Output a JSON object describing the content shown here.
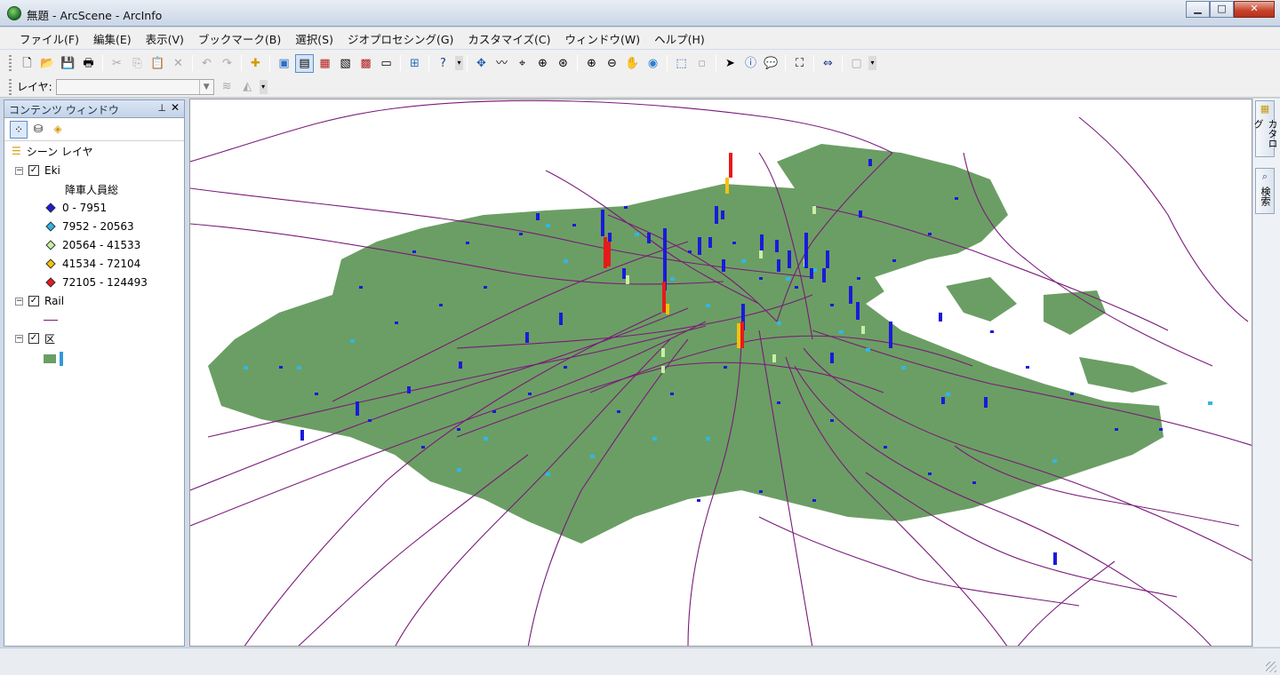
{
  "window": {
    "title": "無題 - ArcScene - ArcInfo",
    "min": "▁",
    "max": "□",
    "close": "✕"
  },
  "menu": [
    "ファイル(F)",
    "編集(E)",
    "表示(V)",
    "ブックマーク(B)",
    "選択(S)",
    "ジオプロセシング(G)",
    "カスタマイズ(C)",
    "ウィンドウ(W)",
    "ヘルプ(H)"
  ],
  "toolbar": {
    "layer_label": "レイヤ:",
    "layer_value": ""
  },
  "toc": {
    "title": "コンテンツ ウィンドウ",
    "root": "シーン レイヤ",
    "layers": [
      {
        "name": "Eki",
        "checked": true,
        "field": "降車人員総"
      },
      {
        "name": "Rail",
        "checked": true
      },
      {
        "name": "区",
        "checked": true
      }
    ],
    "classes": [
      {
        "label": "0 - 7951",
        "color": "#1a1adb"
      },
      {
        "label": "7952 - 20563",
        "color": "#2fb7e6"
      },
      {
        "label": "20564 - 41533",
        "color": "#c9f0a2"
      },
      {
        "label": "41534 - 72104",
        "color": "#f3c20f"
      },
      {
        "label": "72105 - 124493",
        "color": "#e51b1b"
      }
    ],
    "colors": {
      "rail": "#7a1a7a",
      "ward_fill": "#6b9e64",
      "ward_edge": "#3399dd"
    }
  },
  "right_dock": {
    "catalog": "カタログ",
    "search": "検索"
  }
}
